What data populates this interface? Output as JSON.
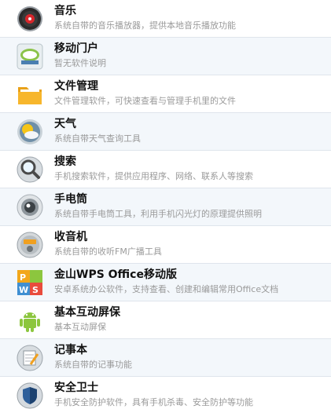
{
  "apps": [
    {
      "title": "音乐",
      "desc": "系统自带的音乐播放器，提供本地音乐播放功能",
      "icon": "music-disc-icon"
    },
    {
      "title": "移动门户",
      "desc": "暂无软件说明",
      "icon": "portal-icon"
    },
    {
      "title": "文件管理",
      "desc": "文件管理软件，可快速查看与管理手机里的文件",
      "icon": "folder-icon"
    },
    {
      "title": "天气",
      "desc": "系统自带天气查询工具",
      "icon": "weather-icon"
    },
    {
      "title": "搜索",
      "desc": "手机搜索软件，提供应用程序、网络、联系人等搜索",
      "icon": "search-icon"
    },
    {
      "title": "手电筒",
      "desc": "系统自带手电筒工具，利用手机闪光灯的原理提供照明",
      "icon": "flashlight-icon"
    },
    {
      "title": "收音机",
      "desc": "系统自带的收听FM广播工具",
      "icon": "radio-icon"
    },
    {
      "title": "金山WPS Office移动版",
      "desc": "安卓系统办公软件，支持查看、创建和编辑常用Office文档",
      "icon": "wps-office-icon"
    },
    {
      "title": "基本互动屏保",
      "desc": "基本互动屏保",
      "icon": "android-icon"
    },
    {
      "title": "记事本",
      "desc": "系统自带的记事功能",
      "icon": "notepad-icon"
    },
    {
      "title": "安全卫士",
      "desc": "手机安全防护软件，具有手机杀毒、安全防护等功能",
      "icon": "shield-icon"
    }
  ]
}
